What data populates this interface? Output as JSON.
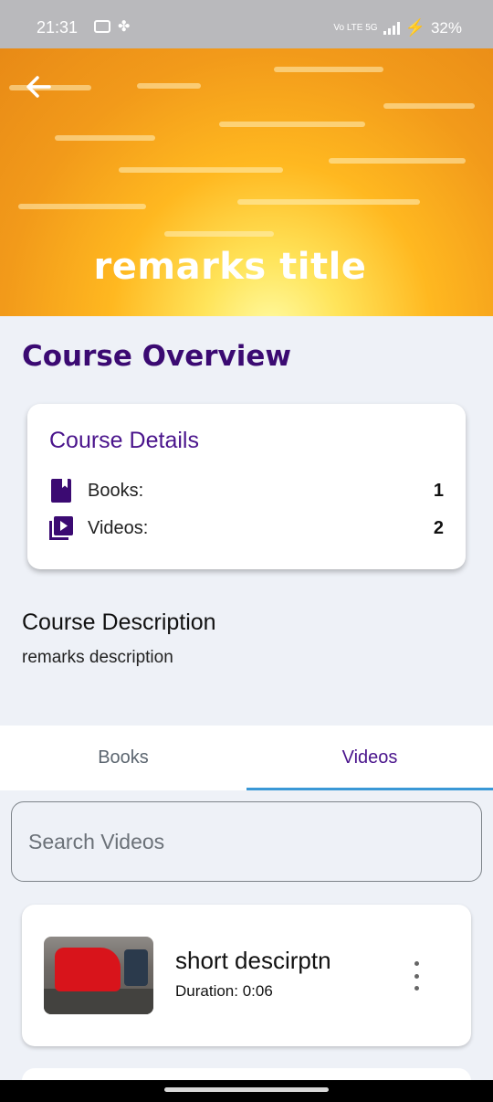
{
  "status_bar": {
    "time": "21:31",
    "network": "Vo LTE 5G",
    "battery": "32%"
  },
  "header": {
    "title": "remarks title"
  },
  "overview": {
    "heading": "Course Overview"
  },
  "details": {
    "title": "Course Details",
    "books_label": "Books:",
    "books_count": "1",
    "videos_label": "Videos:",
    "videos_count": "2"
  },
  "description": {
    "heading": "Course Description",
    "text": "remarks description"
  },
  "tabs": [
    {
      "label": "Books",
      "active": false
    },
    {
      "label": "Videos",
      "active": true
    }
  ],
  "search": {
    "placeholder": "Search Videos",
    "value": ""
  },
  "videos": [
    {
      "title": "short descirptn",
      "duration": "Duration: 0:06"
    }
  ],
  "colors": {
    "accent": "#4a148c",
    "tab_indicator": "#3a98d6",
    "status_bar": "#b9b9bc"
  },
  "icons": {
    "back": "arrow-left-icon",
    "books": "book-icon",
    "videos": "video-library-icon",
    "more": "more-vert-icon"
  }
}
